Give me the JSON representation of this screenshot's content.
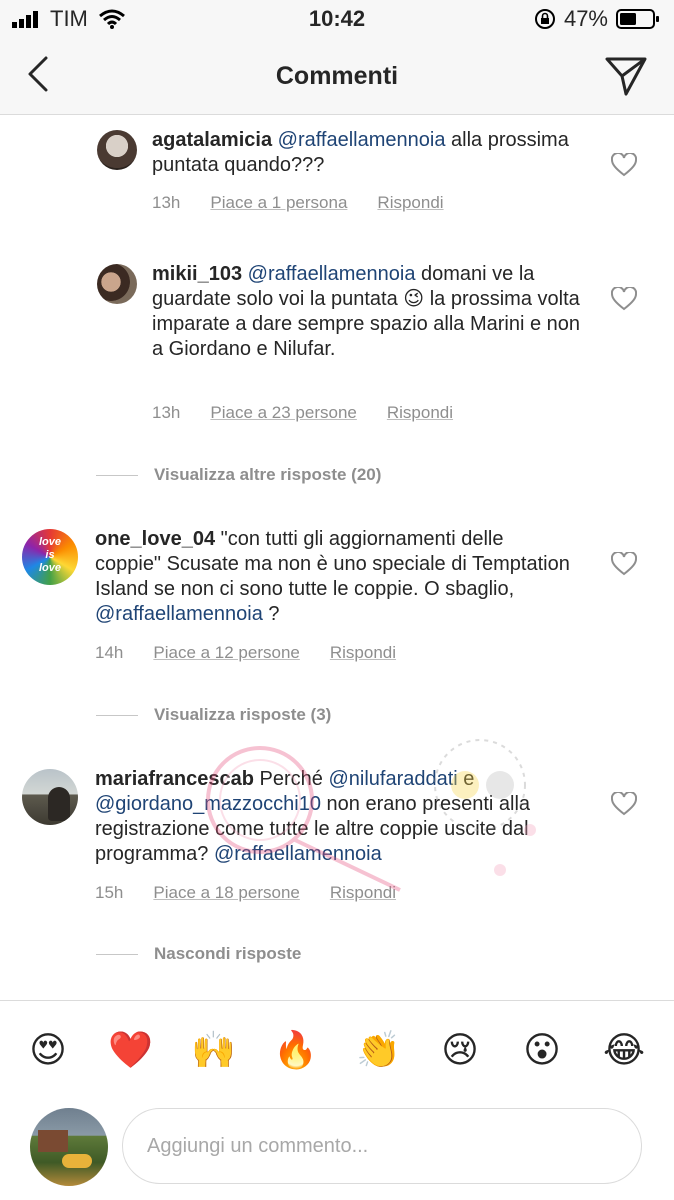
{
  "status_bar": {
    "carrier": "TIM",
    "time": "10:42",
    "battery": "47%"
  },
  "nav": {
    "title": "Commenti"
  },
  "comments": [
    {
      "username": "agatalamicia",
      "mention": "@raffaellamennoia",
      "text_after": " alla prossima puntata quando???",
      "time": "13h",
      "likes": "Piace a 1 persona",
      "reply": "Rispondi"
    },
    {
      "username": "mikii_103",
      "mention": "@raffaellamennoia",
      "text_after": " domani ve la guardate solo voi la puntata 😉 la prossima volta imparate a dare sempre spazio alla Marini e non a Giordano e Nilufar.",
      "time": "13h",
      "likes": "Piace a 23 persone",
      "reply": "Rispondi"
    },
    {
      "username": "one_love_04",
      "text_before": " \"con tutti gli aggiornamenti delle coppie\" Scusate ma non è uno speciale di Temptation Island se non ci sono tutte le coppie. O sbaglio, ",
      "mention": "@raffaellamennoia",
      "text_after": " ?",
      "time": "14h",
      "likes": "Piace a 12 persone",
      "reply": "Rispondi"
    },
    {
      "username": "mariafrancescab",
      "text_before": " Perché ",
      "mention": "@nilufaraddati",
      "text_mid": " e ",
      "mention2": "@giordano_mazzocchi10",
      "text_mid2": " non erano presenti alla registrazione come tutte le altre coppie uscite dal programma? ",
      "mention3": "@raffaellamennoia",
      "time": "15h",
      "likes": "Piace a 18 persone",
      "reply": "Rispondi"
    }
  ],
  "threads": {
    "more_replies": "Visualizza altre risposte (20)",
    "view_replies": "Visualizza risposte (3)",
    "hide_replies": "Nascondi risposte"
  },
  "emojis": [
    "😍",
    "❤️",
    "🙌",
    "🔥",
    "👏",
    "😢",
    "😮",
    "😂"
  ],
  "input": {
    "placeholder": "Aggiungi un commento..."
  },
  "avatar_badge": {
    "line1": "love",
    "line2": "is",
    "line3": "love"
  }
}
